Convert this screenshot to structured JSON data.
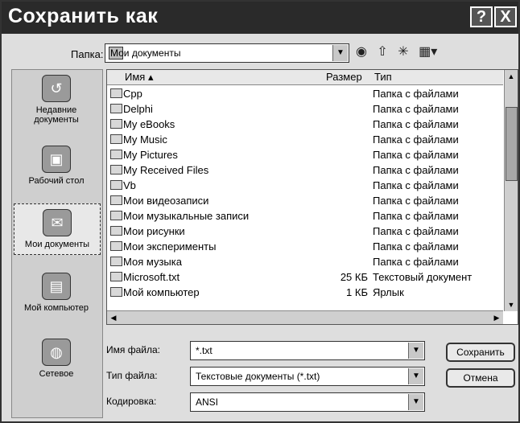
{
  "window": {
    "title": "Сохранить как",
    "help_label": "?",
    "close_label": "X"
  },
  "location": {
    "label": "Папка:",
    "value": "Мои документы"
  },
  "toolbar": {
    "icons": [
      "back-icon",
      "up-folder-icon",
      "new-folder-icon",
      "view-menu-icon"
    ]
  },
  "places": [
    {
      "label": "Недавние документы",
      "icon": "recent-documents-icon"
    },
    {
      "label": "Рабочий стол",
      "icon": "desktop-icon"
    },
    {
      "label": "Мои документы",
      "icon": "my-documents-icon"
    },
    {
      "label": "Мой компьютер",
      "icon": "my-computer-icon"
    },
    {
      "label": "Сетевое",
      "icon": "network-icon"
    }
  ],
  "list": {
    "columns": {
      "name": "Имя",
      "size": "Размер",
      "type": "Тип"
    },
    "items": [
      {
        "name": "Cpp",
        "size": "",
        "type": "Папка с файлами"
      },
      {
        "name": "Delphi",
        "size": "",
        "type": "Папка с файлами"
      },
      {
        "name": "My eBooks",
        "size": "",
        "type": "Папка с файлами"
      },
      {
        "name": "My Music",
        "size": "",
        "type": "Папка с файлами"
      },
      {
        "name": "My Pictures",
        "size": "",
        "type": "Папка с файлами"
      },
      {
        "name": "My Received Files",
        "size": "",
        "type": "Папка с файлами"
      },
      {
        "name": "Vb",
        "size": "",
        "type": "Папка с файлами"
      },
      {
        "name": "Мои видеозаписи",
        "size": "",
        "type": "Папка с файлами"
      },
      {
        "name": "Мои музыкальные записи",
        "size": "",
        "type": "Папка с файлами"
      },
      {
        "name": "Мои рисунки",
        "size": "",
        "type": "Папка с файлами"
      },
      {
        "name": "Мои эксперименты",
        "size": "",
        "type": "Папка с файлами"
      },
      {
        "name": "Моя музыка",
        "size": "",
        "type": "Папка с файлами"
      },
      {
        "name": "Microsoft.txt",
        "size": "25 КБ",
        "type": "Текстовый документ"
      },
      {
        "name": "Мой компьютер",
        "size": "1 КБ",
        "type": "Ярлык"
      }
    ]
  },
  "form": {
    "filename": {
      "label": "Имя файла:",
      "value": "*.txt"
    },
    "filetype": {
      "label": "Тип файла:",
      "value": "Текстовые документы (*.txt)"
    },
    "encoding": {
      "label": "Кодировка:",
      "value": "ANSI"
    },
    "save_label": "Сохранить",
    "cancel_label": "Отмена"
  }
}
